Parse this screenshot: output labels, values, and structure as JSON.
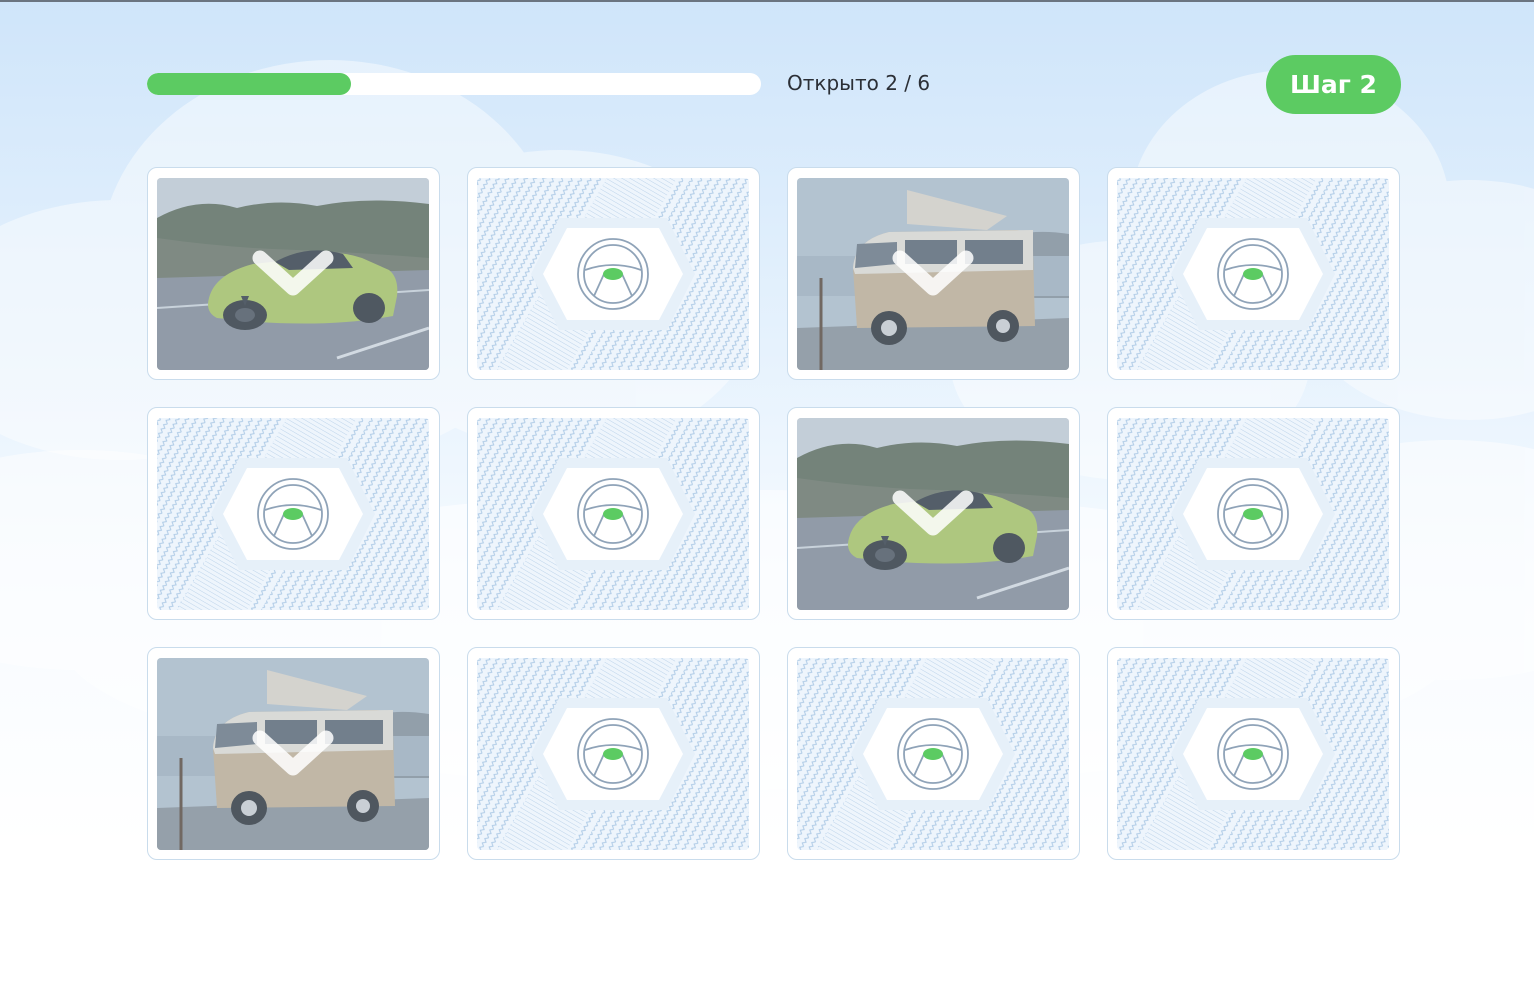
{
  "game": {
    "progress": {
      "label": "Открыто 2 / 6",
      "opened": 2,
      "total": 6,
      "fraction": 0.333
    },
    "step_label": "Шаг 2"
  },
  "colors": {
    "accent_green": "#5ccb62",
    "card_back_blue": "#a9c7e4",
    "text_dark": "#2b2f36"
  },
  "cards": [
    {
      "state": "matched",
      "image": "sports-car"
    },
    {
      "state": "hidden",
      "image": "steering-wheel"
    },
    {
      "state": "matched",
      "image": "camper-van"
    },
    {
      "state": "hidden",
      "image": "steering-wheel"
    },
    {
      "state": "hidden",
      "image": "steering-wheel"
    },
    {
      "state": "hidden",
      "image": "steering-wheel"
    },
    {
      "state": "matched",
      "image": "sports-car"
    },
    {
      "state": "hidden",
      "image": "steering-wheel"
    },
    {
      "state": "matched",
      "image": "camper-van"
    },
    {
      "state": "hidden",
      "image": "steering-wheel"
    },
    {
      "state": "hidden",
      "image": "steering-wheel"
    },
    {
      "state": "hidden",
      "image": "steering-wheel"
    }
  ]
}
